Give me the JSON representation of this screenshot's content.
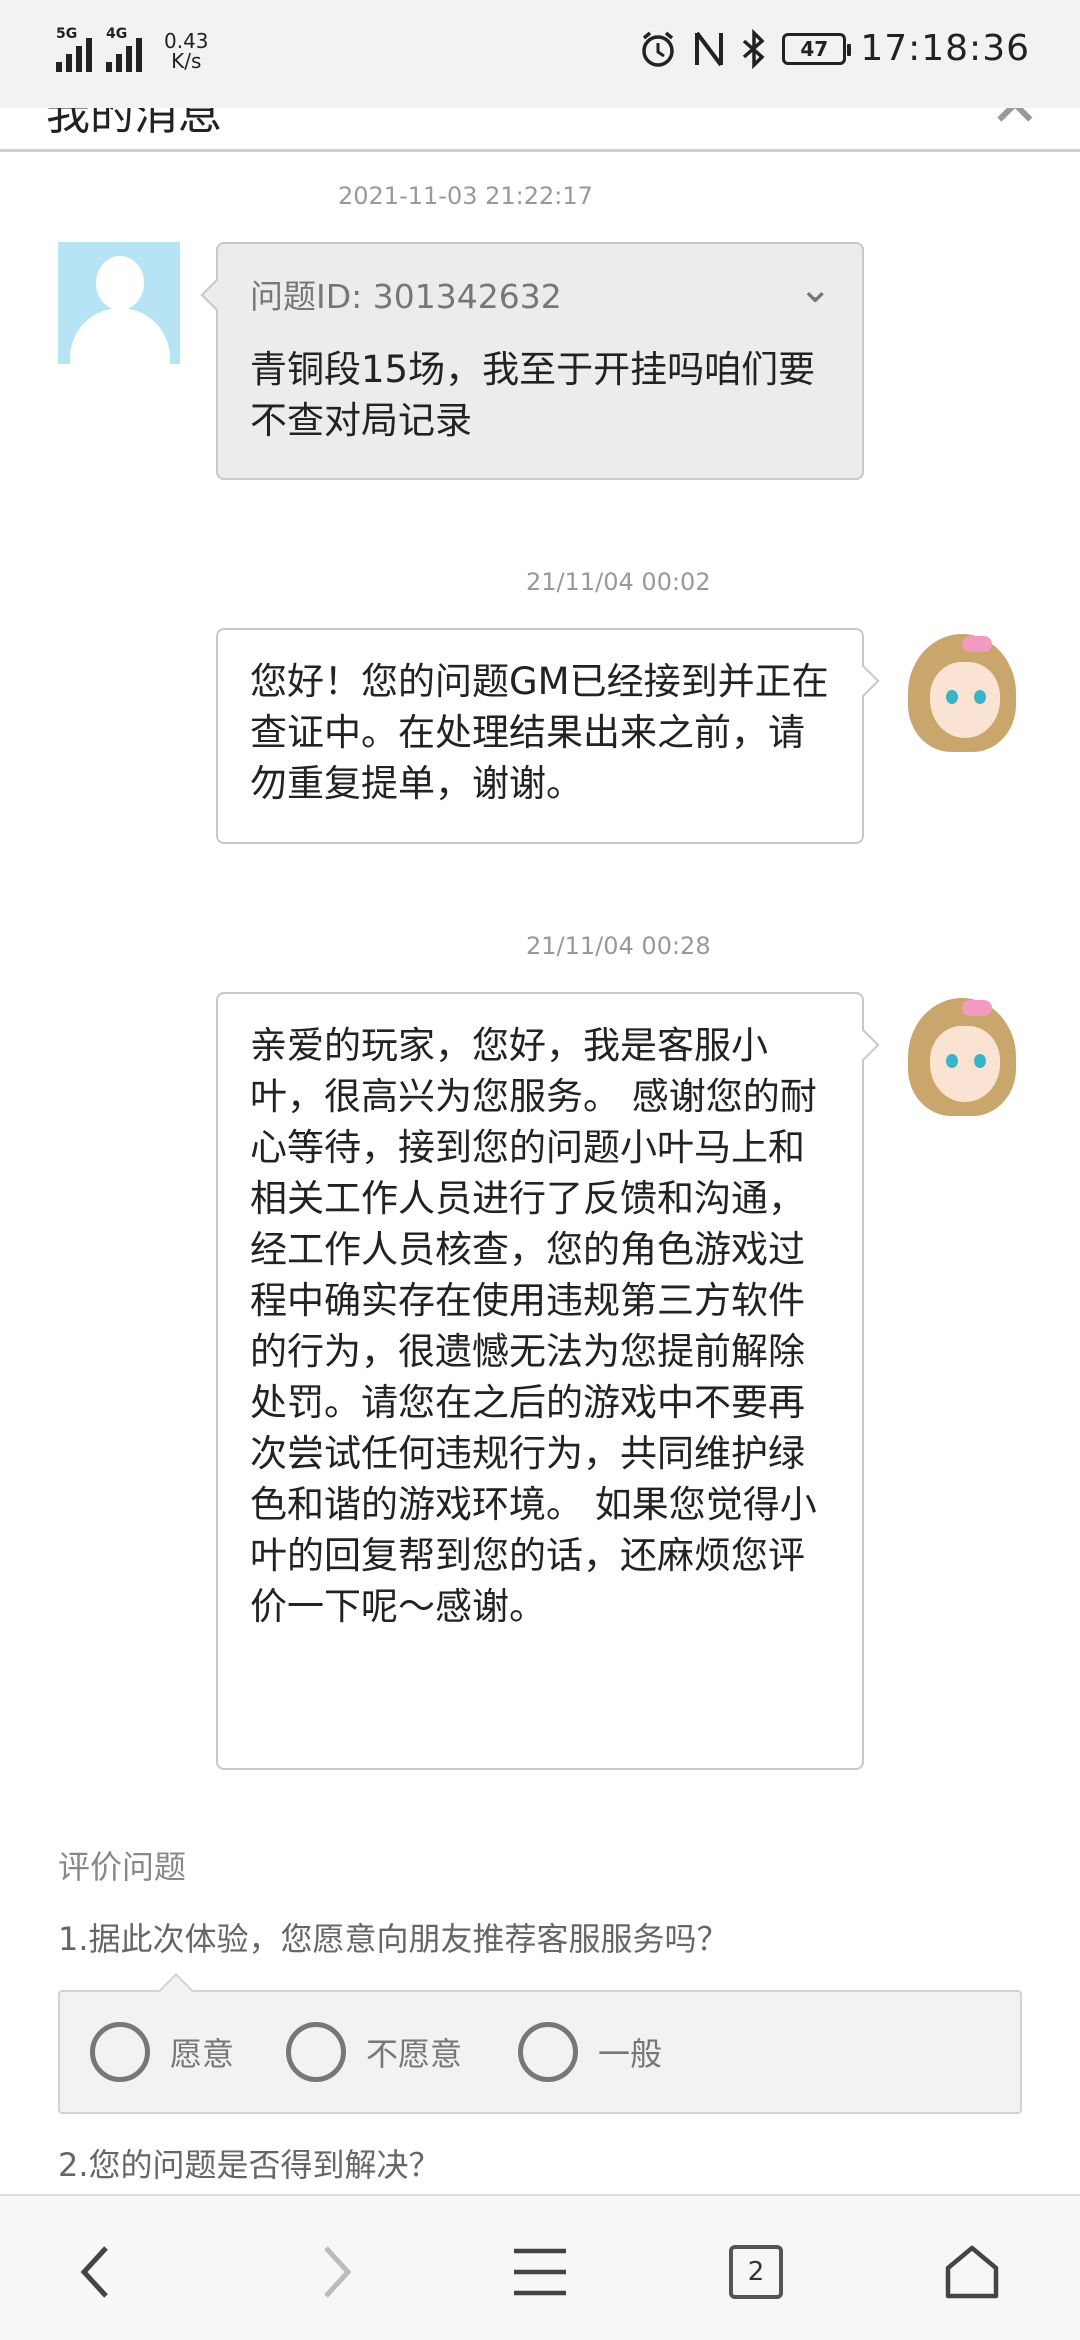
{
  "status_bar": {
    "network1": "5G",
    "network2": "4G",
    "speed_value": "0.43",
    "speed_unit": "K/s",
    "battery": "47",
    "time": "17:18:36"
  },
  "header": {
    "title": "我的消息",
    "close_icon": "close-icon"
  },
  "messages": [
    {
      "sender": "user",
      "timestamp": "2021-11-03 21:22:17",
      "question_id": "问题ID: 301342632",
      "text": "青铜段15场，我至于开挂吗咱们要不查对局记录"
    },
    {
      "sender": "gm",
      "timestamp": "21/11/04 00:02",
      "text": "您好！您的问题GM已经接到并正在查证中。在处理结果出来之前，请勿重复提单，谢谢。"
    },
    {
      "sender": "gm",
      "timestamp": "21/11/04 00:28",
      "text": "亲爱的玩家，您好，我是客服小叶，很高兴为您服务。  感谢您的耐心等待，接到您的问题小叶马上和相关工作人员进行了反馈和沟通，经工作人员核查，您的角色游戏过程中确实存在使用违规第三方软件的行为，很遗憾无法为您提前解除处罚。请您在之后的游戏中不要再次尝试任何违规行为，共同维护绿色和谐的游戏环境。  如果您觉得小叶的回复帮到您的话，还麻烦您评价一下呢～感谢。"
    }
  ],
  "rating": {
    "title": "评价问题",
    "q1": "1.据此次体验，您愿意向朋友推荐客服服务吗？",
    "options": [
      "愿意",
      "不愿意",
      "一般"
    ],
    "q2": "2.您的问题是否得到解决？"
  },
  "nav": {
    "tab_count": "2"
  }
}
